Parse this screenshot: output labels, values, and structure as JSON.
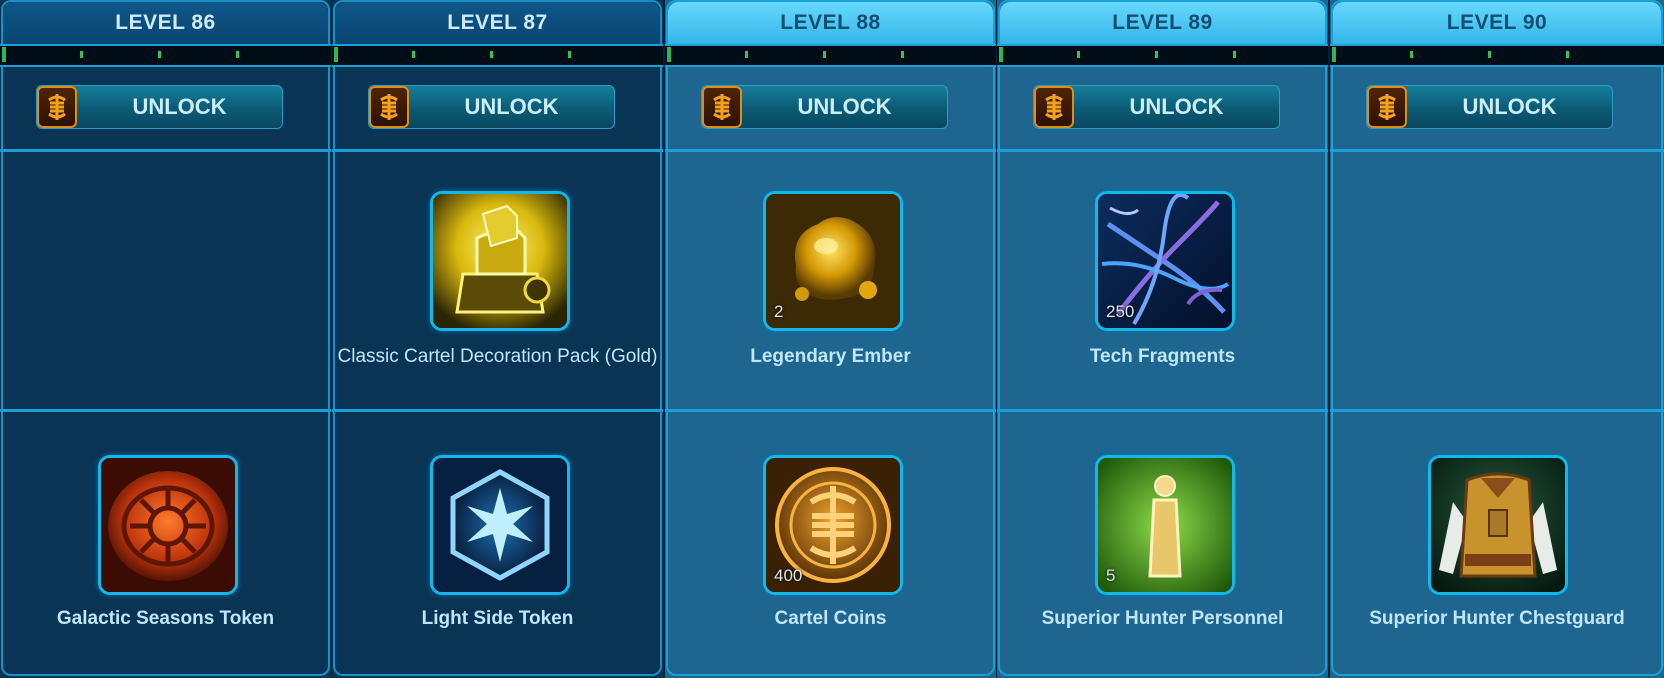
{
  "unlock_label": "UNLOCK",
  "levels": [
    {
      "label": "LEVEL 86",
      "top_reward": null,
      "bottom_reward": {
        "name": "Galactic Seasons Token",
        "quantity": ""
      }
    },
    {
      "label": "LEVEL 87",
      "top_reward": {
        "name": "Classic Cartel Decoration Pack (Gold)",
        "quantity": ""
      },
      "bottom_reward": {
        "name": "Light Side Token",
        "quantity": ""
      }
    },
    {
      "label": "LEVEL 88",
      "top_reward": {
        "name": "Legendary Ember",
        "quantity": "2"
      },
      "bottom_reward": {
        "name": "Cartel Coins",
        "quantity": "400"
      }
    },
    {
      "label": "LEVEL 89",
      "top_reward": {
        "name": "Tech Fragments",
        "quantity": "250"
      },
      "bottom_reward": {
        "name": "Superior Hunter Personnel",
        "quantity": "5"
      }
    },
    {
      "label": "LEVEL 90",
      "top_reward": null,
      "bottom_reward": {
        "name": "Superior Hunter Chestguard",
        "quantity": ""
      }
    }
  ],
  "colors": {
    "frame_cyan": "#1aa0d6",
    "locked_column": "#0a3454",
    "active_column": "#1e6690",
    "coin_orange": "#e08d15",
    "tick_green": "#34c060"
  }
}
